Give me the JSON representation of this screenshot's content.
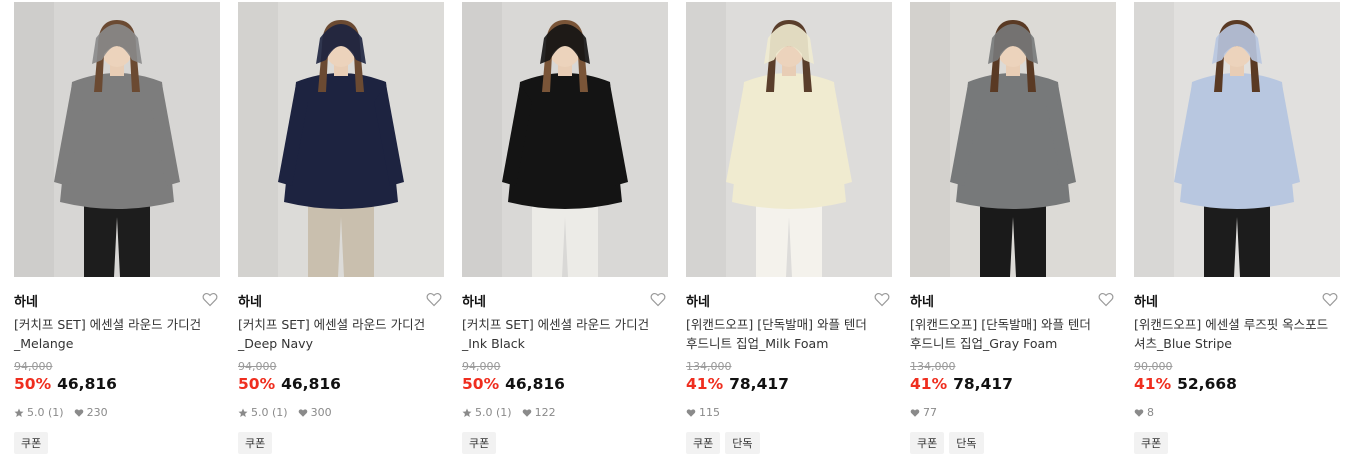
{
  "products": [
    {
      "brand": "하네",
      "title_line1": "[커치프 SET] 에센셜 라운드 가디건",
      "title_line2": "_Melange",
      "original_price": "94,000",
      "discount": "50%",
      "price": "46,816",
      "rating": "5.0 (1)",
      "likes": "230",
      "badges": [
        "쿠폰"
      ],
      "colors": {
        "bg": "#d7d6d4",
        "top": "#7d7d7d",
        "bottom": "#1d1d1d",
        "hair": "#6b4a32",
        "scarf": "#8a8a8a"
      }
    },
    {
      "brand": "하네",
      "title_line1": "[커치프 SET] 에센셜 라운드 가디건",
      "title_line2": "_Deep Navy",
      "original_price": "94,000",
      "discount": "50%",
      "price": "46,816",
      "rating": "5.0 (1)",
      "likes": "300",
      "badges": [
        "쿠폰"
      ],
      "colors": {
        "bg": "#dcdbd8",
        "top": "#1d2340",
        "bottom": "#c9bfae",
        "hair": "#6b4a32",
        "scarf": "#1d2340"
      }
    },
    {
      "brand": "하네",
      "title_line1": "[커치프 SET] 에센셜 라운드 가디건",
      "title_line2": "_Ink Black",
      "original_price": "94,000",
      "discount": "50%",
      "price": "46,816",
      "rating": "5.0 (1)",
      "likes": "122",
      "badges": [
        "쿠폰"
      ],
      "colors": {
        "bg": "#d9d8d6",
        "top": "#141414",
        "bottom": "#ecebe7",
        "hair": "#7a5538",
        "scarf": "#141414"
      }
    },
    {
      "brand": "하네",
      "title_line1": "[위캔드오프] [단독발매] 와플 텐더",
      "title_line2": "후드니트 집업_Milk Foam",
      "original_price": "134,000",
      "discount": "41%",
      "price": "78,417",
      "rating": "",
      "likes": "115",
      "badges": [
        "쿠폰",
        "단독"
      ],
      "colors": {
        "bg": "#dddcda",
        "top": "#f0ebd0",
        "bottom": "#f4f2ec",
        "hair": "#5a3e2b",
        "scarf": "#f0ebd0"
      }
    },
    {
      "brand": "하네",
      "title_line1": "[위캔드오프] [단독발매] 와플 텐더",
      "title_line2": "후드니트 집업_Gray Foam",
      "original_price": "134,000",
      "discount": "41%",
      "price": "78,417",
      "rating": "",
      "likes": "77",
      "badges": [
        "쿠폰",
        "단독"
      ],
      "colors": {
        "bg": "#dcdad6",
        "top": "#77797a",
        "bottom": "#1a1a1a",
        "hair": "#5a3a24",
        "scarf": "#77797a"
      }
    },
    {
      "brand": "하네",
      "title_line1": "[위캔드오프] 에센셜 루즈핏 옥스포드",
      "title_line2": "셔츠_Blue Stripe",
      "original_price": "90,000",
      "discount": "41%",
      "price": "52,668",
      "rating": "",
      "likes": "8",
      "badges": [
        "쿠폰"
      ],
      "colors": {
        "bg": "#e1e0de",
        "top": "#b8c7e0",
        "bottom": "#1c1c1c",
        "hair": "#5a3a24",
        "scarf": "#b8c7e0"
      }
    }
  ],
  "icons": {
    "wishlist": "heart-outline-icon",
    "rating": "star-icon",
    "likes": "heart-filled-icon"
  }
}
